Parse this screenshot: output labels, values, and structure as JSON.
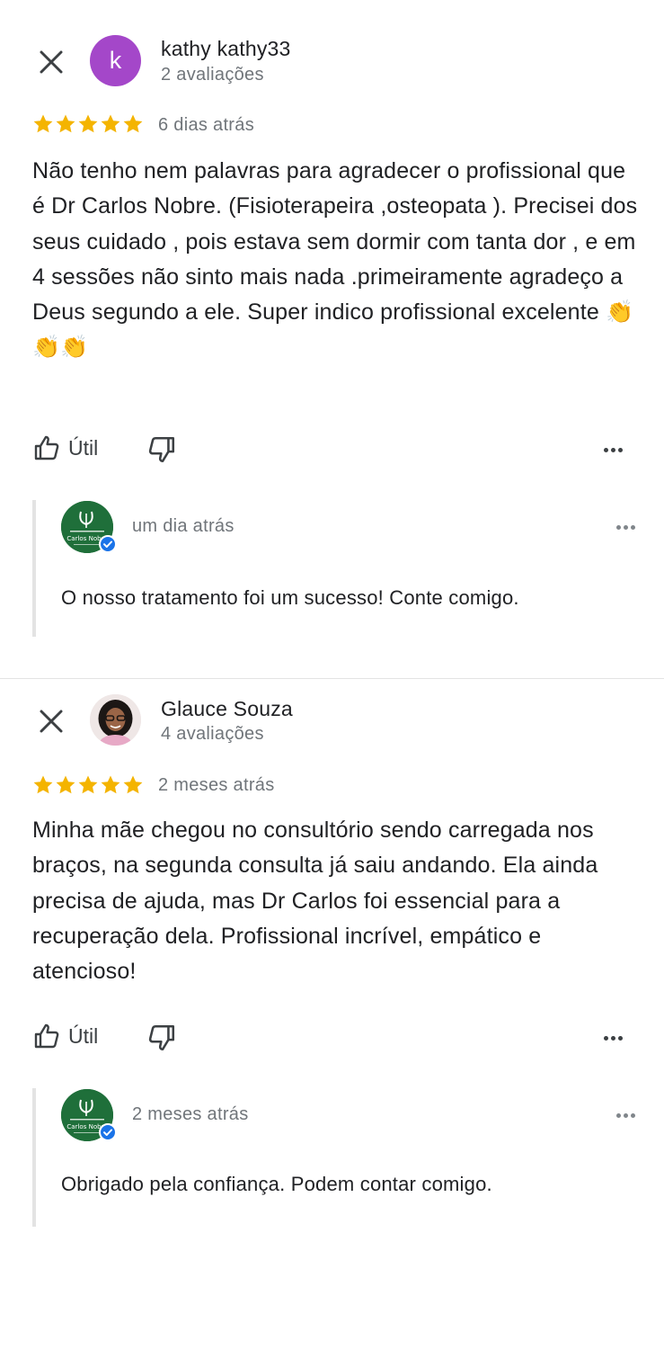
{
  "reviews": [
    {
      "author_name": "kathy kathy33",
      "author_reviews": "2 avaliações",
      "avatar_letter": "k",
      "rating": 5,
      "time": "6 dias atrás",
      "text": "Não tenho nem palavras para agradecer o profissional que é Dr Carlos Nobre. (Fisioterapeira ,osteopata ). Precisei dos seus cuidado , pois estava sem dormir com tanta dor , e em 4 sessões não sinto mais nada .primeiramente agradeço a Deus segundo a ele. Super indico profissional excelente 👏👏👏",
      "useful_label": "Útil",
      "reply": {
        "logo_text": "Carlos Nobre",
        "time": "um dia atrás",
        "text": "O nosso tratamento foi um sucesso! Conte comigo."
      }
    },
    {
      "author_name": "Glauce Souza",
      "author_reviews": "4 avaliações",
      "rating": 5,
      "time": "2 meses atrás",
      "text": "Minha mãe chegou no consultório sendo carregada nos braços, na segunda consulta já saiu andando. Ela ainda precisa de ajuda, mas Dr Carlos foi essencial para a recuperação dela. Profissional incrível, empático e atencioso!",
      "useful_label": "Útil",
      "reply": {
        "logo_text": "Carlos Nobre",
        "time": "2 meses atrás",
        "text": "Obrigado pela confiança. Podem contar comigo."
      }
    }
  ],
  "colors": {
    "star": "#F4B400",
    "avatar_k": "#A447C9",
    "logo_green": "#1F6F3A",
    "verified_blue": "#1A73E8",
    "secondary_text": "#70757A"
  },
  "icons": {
    "close": "close-icon",
    "thumb_up": "thumb-up-icon",
    "thumb_down": "thumb-down-icon",
    "more": "more-horizontal-icon",
    "verified": "verified-check-icon",
    "star": "star-icon"
  }
}
